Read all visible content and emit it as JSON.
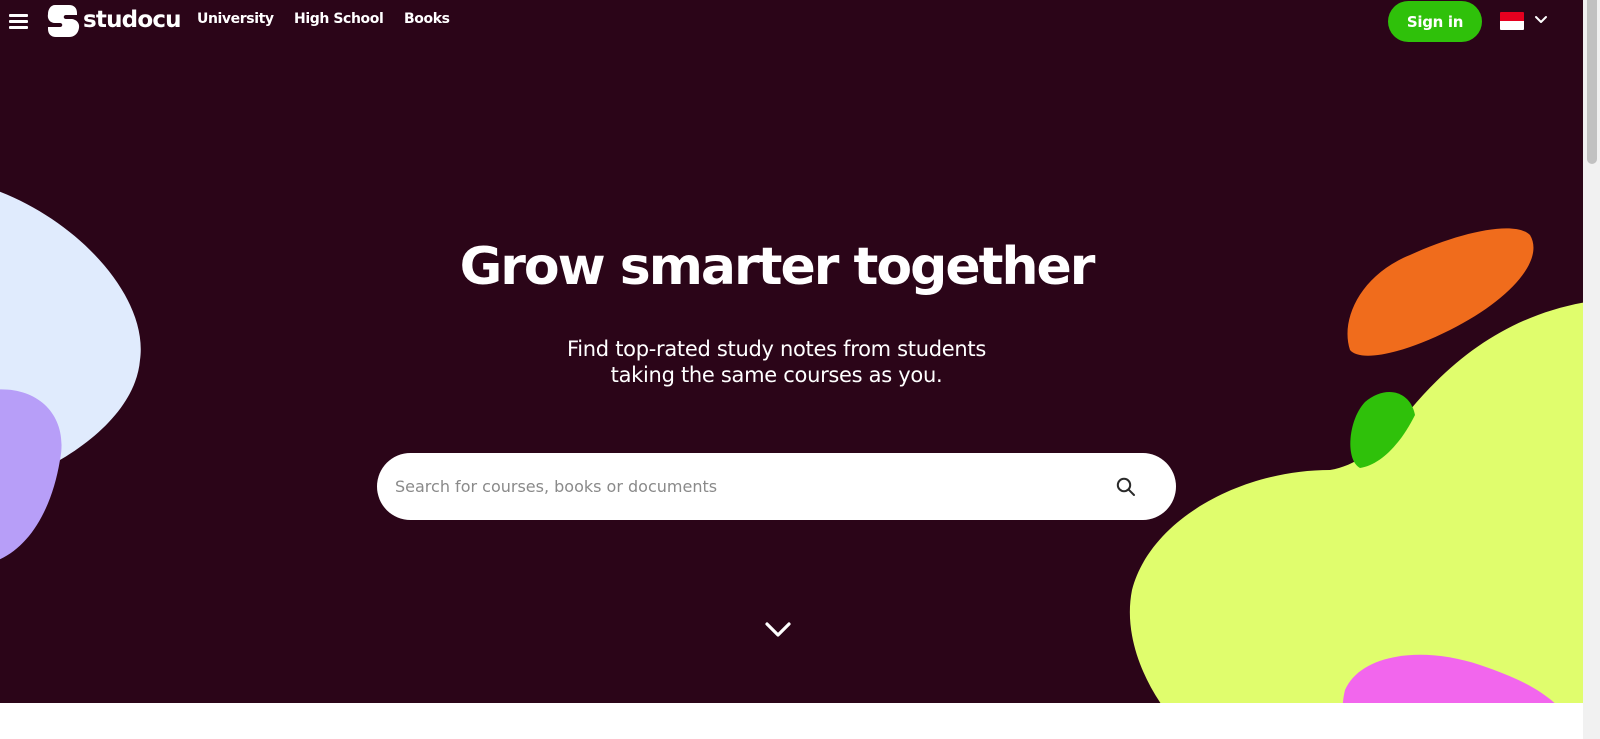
{
  "header": {
    "logo_text": "studocu",
    "nav": [
      {
        "label": "University"
      },
      {
        "label": "High School"
      },
      {
        "label": "Books"
      }
    ],
    "signin_label": "Sign in",
    "language": {
      "flag": "Indonesia",
      "flag_colors": [
        "#e5001f",
        "#ffffff"
      ]
    }
  },
  "hero": {
    "headline": "Grow smarter together",
    "subtitle_line1": "Find top-rated study notes from students",
    "subtitle_line2": "taking the same courses as you.",
    "search": {
      "placeholder": "Search for courses, books or documents",
      "value": ""
    }
  },
  "icons": {
    "menu": "hamburger-icon",
    "search": "magnifier-icon",
    "scroll_down": "chevron-down-icon",
    "language_toggle": "chevron-down-icon"
  },
  "colors": {
    "hero_background": "#2b0518",
    "accent_green": "#2fc10a",
    "blob_lavender": "#e0ebfd",
    "blob_purple": "#b79ef8",
    "blob_orange": "#f06c1c",
    "blob_lime": "#e0fd6d",
    "blob_pink": "#f266ed",
    "blob_green": "#2fc10a"
  }
}
